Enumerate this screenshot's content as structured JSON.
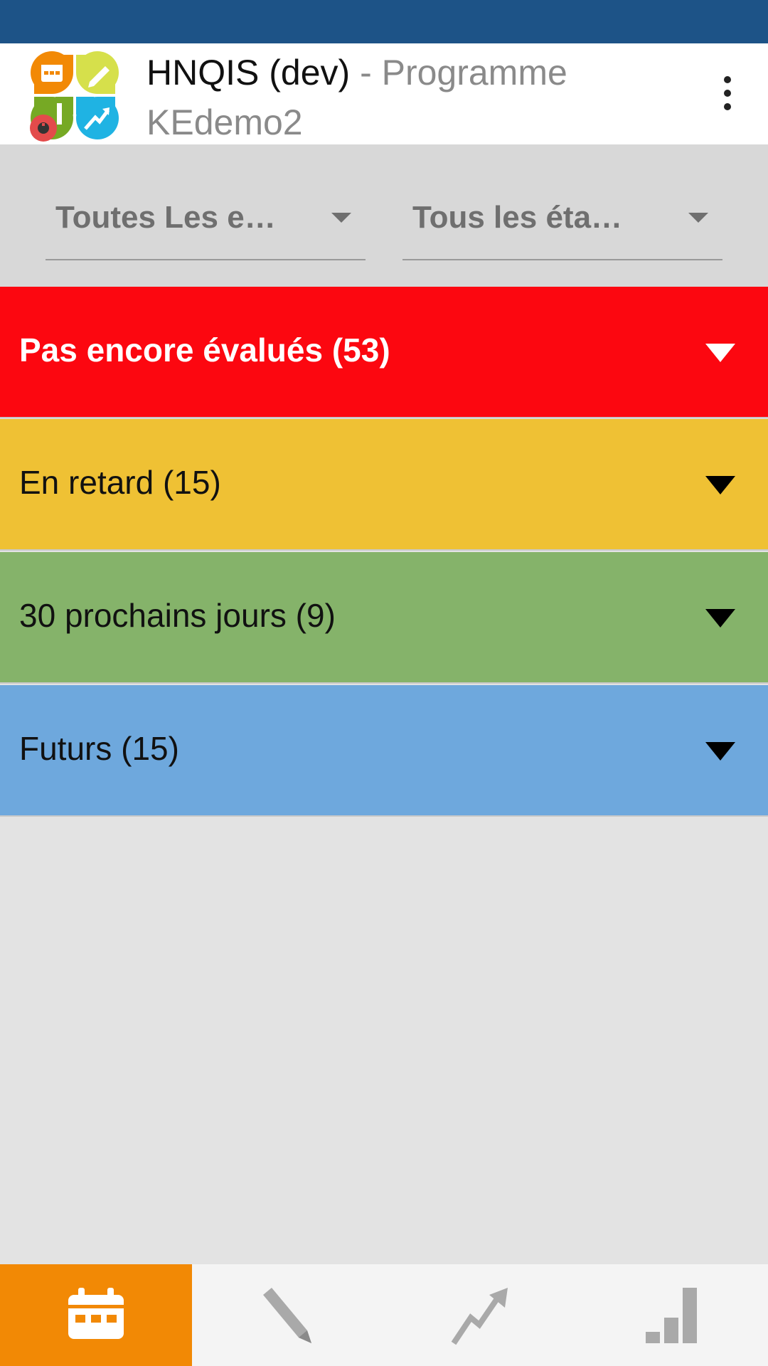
{
  "app_bar": {
    "app_name": "HNQIS (dev)",
    "separator": " - ",
    "program": "Programme KEdemo2",
    "menu_icon": "overflow-menu-icon",
    "logo_icon": "hnqis-logo-icon"
  },
  "filters": {
    "org_unit": {
      "selected": "Toutes Les e…"
    },
    "status": {
      "selected": "Tous les éta…"
    }
  },
  "sections": [
    {
      "label": "Pas encore évalués (53)",
      "color": "#fc0710"
    },
    {
      "label": "En retard (15)",
      "color": "#efc134"
    },
    {
      "label": "30 prochains jours (9)",
      "color": "#85b36a"
    },
    {
      "label": "Futurs (15)",
      "color": "#6ea8dd"
    }
  ],
  "bottom_nav": {
    "active_color": "#f28905",
    "tabs": [
      {
        "icon": "calendar-icon",
        "active": true
      },
      {
        "icon": "pencil-icon",
        "active": false
      },
      {
        "icon": "trend-arrow-icon",
        "active": false
      },
      {
        "icon": "bar-chart-icon",
        "active": false
      }
    ]
  },
  "colors": {
    "status_bar": "#1d5387",
    "background": "#e3e3e3",
    "filter_bar": "#d8d8d8"
  }
}
